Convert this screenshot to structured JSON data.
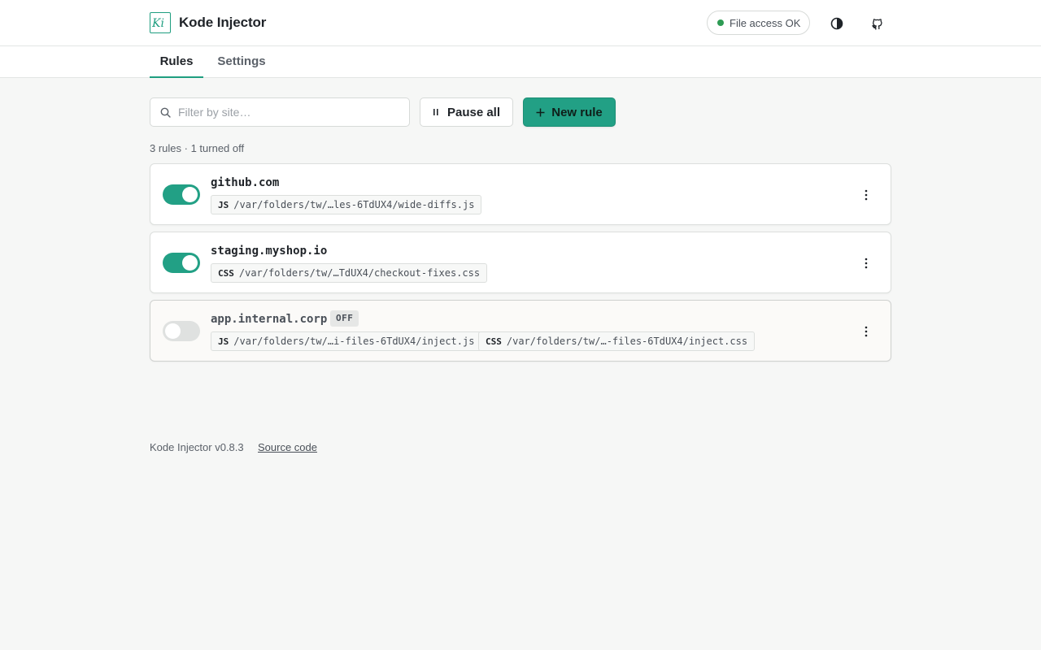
{
  "app": {
    "title": "Kode Injector",
    "logo_text": "Ki",
    "brand_color": "#1f9e80"
  },
  "header": {
    "status": {
      "label": "File access OK",
      "color": "#2e9b54"
    },
    "theme_icon": "contrast-icon",
    "github_icon": "github-icon"
  },
  "tabs": [
    {
      "label": "Rules",
      "active": true
    },
    {
      "label": "Settings",
      "active": false
    }
  ],
  "toolbar": {
    "search": {
      "placeholder": "Filter by site…",
      "value": ""
    },
    "pause_label": "Pause all",
    "new_rule_label": "New rule"
  },
  "summary": "3 rules · 1 turned off",
  "rules": [
    {
      "site": "github.com",
      "enabled": true,
      "files": [
        {
          "kind": "JS",
          "path": "/var/folders/tw/…les-6TdUX4/wide-diffs.js"
        }
      ]
    },
    {
      "site": "staging.myshop.io",
      "enabled": true,
      "files": [
        {
          "kind": "CSS",
          "path": "/var/folders/tw/…TdUX4/checkout-fixes.css"
        }
      ]
    },
    {
      "site": "app.internal.corp",
      "enabled": false,
      "badge": "OFF",
      "files": [
        {
          "kind": "JS",
          "path": "/var/folders/tw/…i-files-6TdUX4/inject.js"
        },
        {
          "kind": "CSS",
          "path": "/var/folders/tw/…-files-6TdUX4/inject.css"
        }
      ]
    }
  ],
  "footer": {
    "version": "Kode Injector v0.8.3",
    "source_link": "Source code"
  }
}
